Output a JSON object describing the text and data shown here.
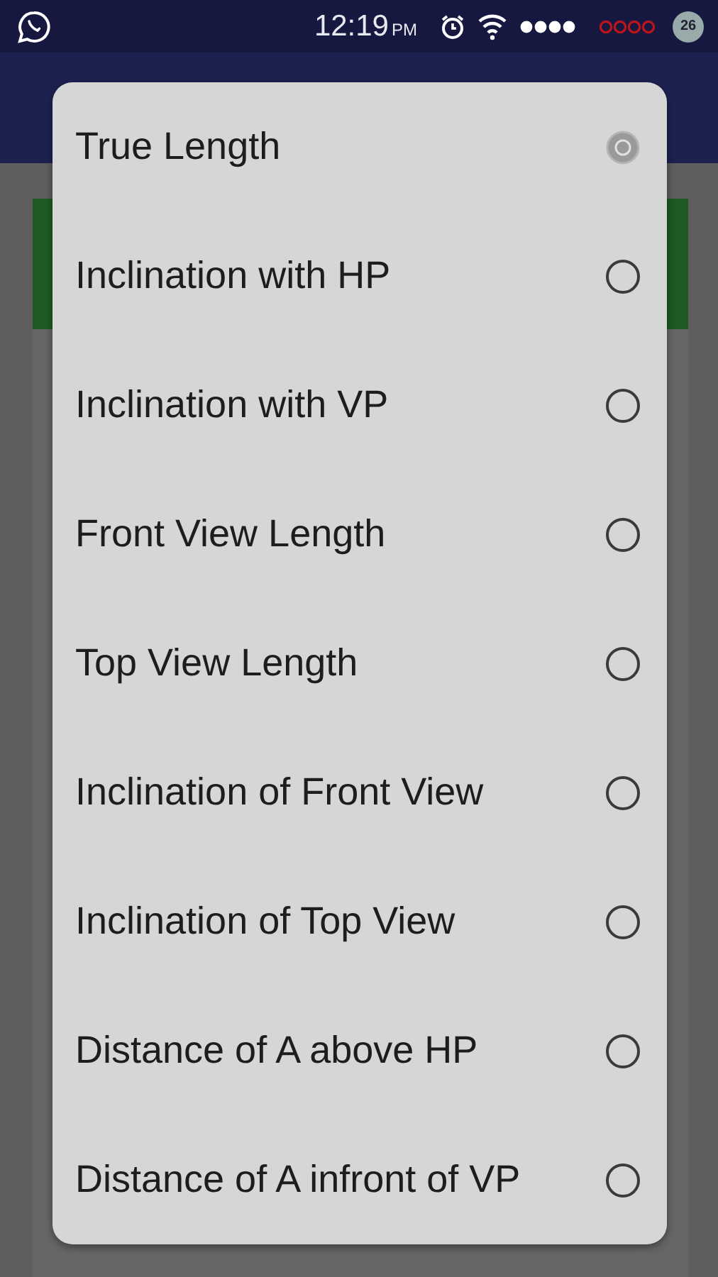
{
  "status_bar": {
    "time": "12:19",
    "meridiem": "PM",
    "battery": "26"
  },
  "dialog": {
    "options": [
      {
        "label": "True Length",
        "selected": true
      },
      {
        "label": "Inclination with HP",
        "selected": false
      },
      {
        "label": "Inclination with VP",
        "selected": false
      },
      {
        "label": "Front View Length",
        "selected": false
      },
      {
        "label": "Top View Length",
        "selected": false
      },
      {
        "label": "Inclination of Front View",
        "selected": false
      },
      {
        "label": "Inclination of Top View",
        "selected": false
      },
      {
        "label": "Distance of A above HP",
        "selected": false
      },
      {
        "label": "Distance of A infront of VP",
        "selected": false
      }
    ]
  }
}
